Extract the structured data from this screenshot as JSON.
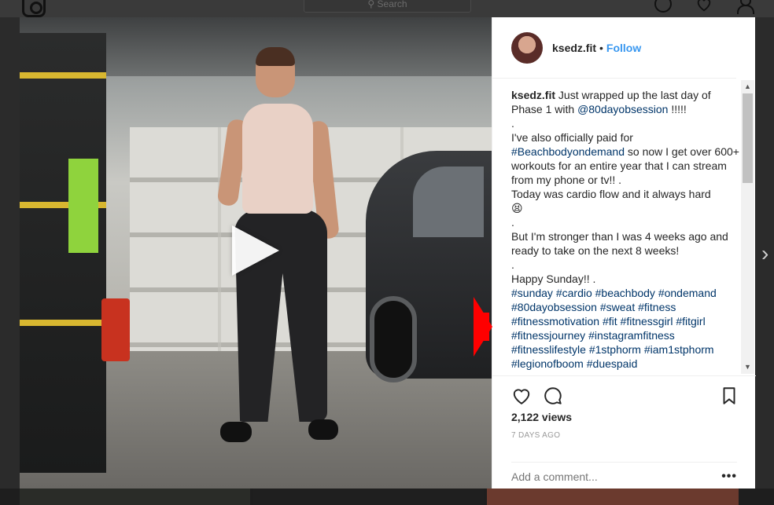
{
  "top": {
    "search_placeholder": "Search"
  },
  "post": {
    "username": "ksedz.fit",
    "separator": "•",
    "follow_label": "Follow",
    "caption_lines": [
      {
        "type": "lead",
        "user": "ksedz.fit",
        "text": " Just wrapped up the last day of Phase 1 with ",
        "link": "@80dayobsession",
        "tail": " !!!!!"
      },
      {
        "type": "text",
        "text": "."
      },
      {
        "type": "mixed",
        "pre": "I've also officially paid for ",
        "link": "#Beachbodyondemand",
        "post": " so now I get over 600+ workouts for an entire year that I can stream from my phone or tv!! ."
      },
      {
        "type": "text",
        "text": "Today was cardio flow and it always hard"
      },
      {
        "type": "text",
        "text": "😫"
      },
      {
        "type": "text",
        "text": "."
      },
      {
        "type": "text",
        "text": "But I'm stronger than I was 4 weeks ago and ready to take on the next 8 weeks!"
      },
      {
        "type": "text",
        "text": "."
      },
      {
        "type": "text",
        "text": "Happy Sunday!! ."
      }
    ],
    "hashtags": [
      "#sunday",
      "#cardio",
      "#beachbody",
      "#ondemand",
      "#80dayobsession",
      "#sweat",
      "#fitness",
      "#fitnessmotivation",
      "#fit",
      "#fitnessgirl",
      "#fitgirl",
      "#fitnessjourney",
      "#instagramfitness",
      "#fitnesslifestyle",
      "#1stphorm",
      "#iam1stphorm",
      "#legionofboom",
      "#duespaid"
    ],
    "views": "2,122 views",
    "time_ago": "7 DAYS AGO",
    "comment_placeholder": "Add a comment...",
    "more_label": "•••"
  },
  "colors": {
    "link": "#003569",
    "follow": "#3897f0",
    "arrow": "#ff0000"
  },
  "icons": [
    "instagram-icon",
    "compass-icon",
    "heart-icon",
    "user-icon",
    "play-icon",
    "comment-icon",
    "bookmark-icon",
    "more-icon",
    "chevron-right-icon"
  ]
}
